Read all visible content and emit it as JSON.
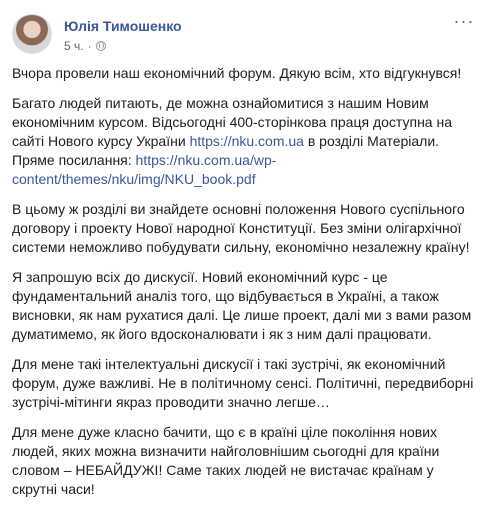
{
  "post": {
    "author": "Юлія Тимошенко",
    "time": "5 ч.",
    "separator": "·",
    "more_icon": "more-options-icon",
    "privacy_icon": "globe-icon",
    "paragraphs": [
      {
        "text": "Вчора провели наш економічний форум. Дякую всім, хто відгукнувся!"
      },
      {
        "pre": "Багато людей питають, де можна ознайомитися з нашим Новим економічним курсом. Відсьогодні 400-сторінкова праця доступна на сайті Нового курсу України ",
        "link1": "https://nku.com.ua",
        "mid": " в розділі Матеріали. Пряме посилання: ",
        "link2": "https://nku.com.ua/wp-content/themes/nku/img/NKU_book.pdf"
      },
      {
        "text": "В цьому ж розділі ви знайдете основні положення Нового суспільного договору і проекту Нової народної Конституції. Без зміни олігархічної системи неможливо побудувати сильну, економічно незалежну країну!"
      },
      {
        "text": "Я запрошую всіх до дискусії. Новий економічний курс - це фундаментальний аналіз того, що відбувається в Україні, а також висновки, як нам рухатися далі. Це лише проект, далі ми з вами разом думатимемо, як його вдосконалювати і як з ним далі працювати."
      },
      {
        "text": "Для мене такі інтелектуальні дискусії і такі зустрічі, як економічний форум, дуже важливі. Не в політичному сенсі. Політичні, передвиборні зустрічі-мітинги якраз проводити значно легше…"
      },
      {
        "text": "Для мене дуже класно бачити, що є в країні ціле покоління нових людей, яких можна визначити найголовнішим сьогодні для країни словом – НЕБАЙДУЖІ! Саме таких людей не вистачає країнам у скрутні часи!"
      }
    ]
  }
}
